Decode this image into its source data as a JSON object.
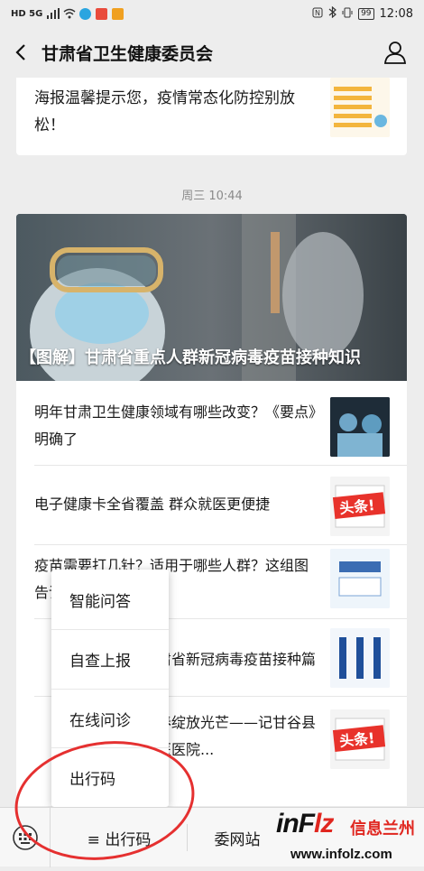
{
  "status_bar": {
    "left_text": "HD 5G",
    "battery": "99",
    "time": "12:08"
  },
  "header": {
    "title": "甘肃省卫生健康委员会"
  },
  "messages": {
    "top_article": "海报温馨提示您，疫情常态化防控别放松！",
    "timestamp": "周三 10:44",
    "hero_title": "【图解】甘肃省重点人群新冠病毒疫苗接种知识",
    "articles": [
      {
        "title": "明年甘肃卫生健康领域有哪些改变？《要点》明确了"
      },
      {
        "title": "电子健康卡全省覆盖 群众就医更便捷"
      },
      {
        "title": "疫苗需要打几针？适用于哪些人群？这组图告诉你"
      },
      {
        "title": "甘肃省新冠病毒疫苗接种篇"
      },
      {
        "title": "青春绽放光芒——记甘谷县中医医院..."
      }
    ],
    "badge_text": "头条!"
  },
  "popup_menu": {
    "items": [
      "智能问答",
      "自查上报",
      "在线问诊",
      "出行码"
    ]
  },
  "bottom_menu": {
    "menu1": "≡ 出行码",
    "menu2": "委网站"
  },
  "watermark": {
    "logo_a": "inF",
    "logo_b": "lz",
    "chinese": "信息兰州",
    "url": "www.infolz.com"
  },
  "colors": {
    "background": "#ededed",
    "annotation": "#e53030",
    "brand_red": "#e0261f"
  }
}
